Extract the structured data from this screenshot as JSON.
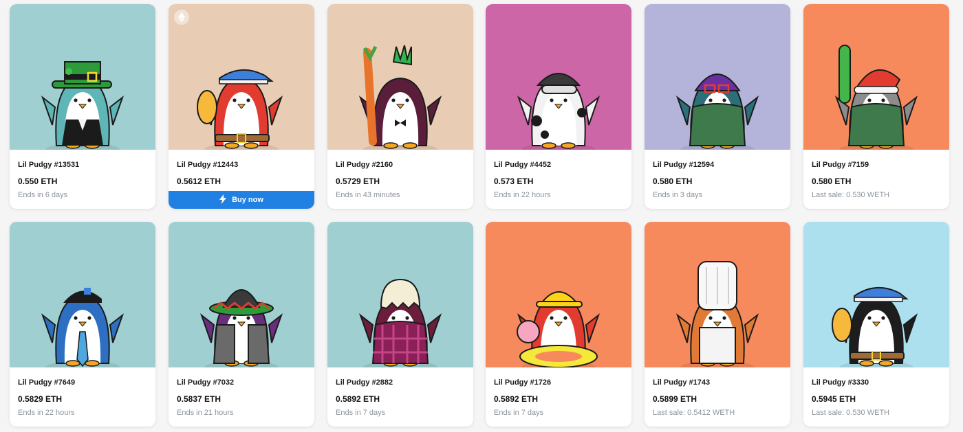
{
  "buy_now_label": "Buy now",
  "cards": [
    {
      "name": "Lil Pudgy #13531",
      "price": "0.550 ETH",
      "sub": "Ends in 6 days",
      "bg": "#9fcfd1",
      "body": "#5fb6b6",
      "hat": "leprechaun",
      "outfit": "tux"
    },
    {
      "name": "Lil Pudgy #12443",
      "price": "0.5612 ETH",
      "sub": "",
      "bg": "#e8cdb4",
      "body": "#e23b2f",
      "hat": "visor",
      "outfit": "belt",
      "buy": true
    },
    {
      "name": "Lil Pudgy #2160",
      "price": "0.5729 ETH",
      "sub": "Ends in 43 minutes",
      "bg": "#e8cdb4",
      "body": "#5a1e3b",
      "hat": "mohawk",
      "outfit": "bowtie"
    },
    {
      "name": "Lil Pudgy #4452",
      "price": "0.573 ETH",
      "sub": "Ends in 22 hours",
      "bg": "#cc66a6",
      "body": "#f2f2f2",
      "hat": "goggles",
      "outfit": "cow"
    },
    {
      "name": "Lil Pudgy #12594",
      "price": "0.580 ETH",
      "sub": "Ends in 3 days",
      "bg": "#b4b4da",
      "body": "#2c6f7a",
      "hat": "beanie",
      "outfit": "sweater"
    },
    {
      "name": "Lil Pudgy #7159",
      "price": "0.580 ETH",
      "sub": "Last sale: 0.530 WETH",
      "bg": "#f68a5c",
      "body": "#8c8c8c",
      "hat": "santa",
      "outfit": "sweater"
    },
    {
      "name": "Lil Pudgy #7649",
      "price": "0.5829 ETH",
      "sub": "Ends in 22 hours",
      "bg": "#9fcfd1",
      "body": "#2d6fc2",
      "hat": "cap",
      "outfit": "tie"
    },
    {
      "name": "Lil Pudgy #7032",
      "price": "0.5837 ETH",
      "sub": "Ends in 21 hours",
      "bg": "#9fcfd1",
      "body": "#6b2d7d",
      "hat": "sombrero",
      "outfit": "coat"
    },
    {
      "name": "Lil Pudgy #2882",
      "price": "0.5892 ETH",
      "sub": "Ends in 7 days",
      "bg": "#9fcfd1",
      "body": "#6b1e3c",
      "hat": "egg",
      "outfit": "plaid"
    },
    {
      "name": "Lil Pudgy #1726",
      "price": "0.5892 ETH",
      "sub": "Ends in 7 days",
      "bg": "#f68a5c",
      "body": "#e23b2f",
      "hat": "hardhat",
      "outfit": "float"
    },
    {
      "name": "Lil Pudgy #1743",
      "price": "0.5899 ETH",
      "sub": "Last sale: 0.5412 WETH",
      "bg": "#f68a5c",
      "body": "#e07a35",
      "hat": "chef",
      "outfit": "apron"
    },
    {
      "name": "Lil Pudgy #3330",
      "price": "0.5945 ETH",
      "sub": "Last sale: 0.530 WETH",
      "bg": "#ade0ee",
      "body": "#1d1d1d",
      "hat": "visor",
      "outfit": "belt"
    }
  ]
}
